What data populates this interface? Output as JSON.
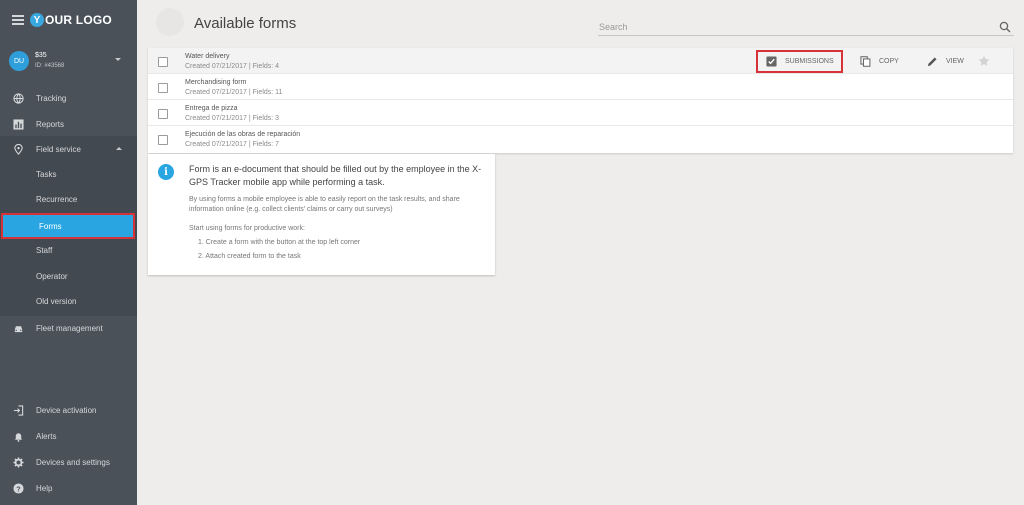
{
  "brand": {
    "logo_letter": "Y",
    "logo_text": "OUR LOGO"
  },
  "account": {
    "initials": "DU",
    "balance": "$35",
    "id": "ID: #43568"
  },
  "nav": {
    "tracking": "Tracking",
    "reports": "Reports",
    "field_service": "Field service",
    "sub": {
      "tasks": "Tasks",
      "recurrence": "Recurrence",
      "forms": "Forms",
      "staff": "Staff",
      "operator": "Operator",
      "old_version": "Old version"
    },
    "fleet": "Fleet management",
    "device_activation": "Device activation",
    "alerts": "Alerts",
    "devices_settings": "Devices and settings",
    "help": "Help"
  },
  "main": {
    "title": "Available forms",
    "search_placeholder": "Search"
  },
  "forms": [
    {
      "name": "Water delivery",
      "meta": "Created 07/21/2017 | Fields: 4"
    },
    {
      "name": "Merchandising form",
      "meta": "Created 07/21/2017 | Fields: 11"
    },
    {
      "name": "Entrega de pizza",
      "meta": "Created 07/21/2017 | Fields: 3"
    },
    {
      "name": "Ejecución de las obras de reparación",
      "meta": "Created 07/21/2017 | Fields: 7"
    }
  ],
  "row_actions": {
    "submissions": "SUBMISSIONS",
    "copy": "COPY",
    "view": "VIEW"
  },
  "info": {
    "icon": "i",
    "title": "Form is an e-document that should be filled out by the employee in the X-GPS Tracker mobile app while performing a task.",
    "body": "By using forms a mobile employee is able to easily report on the task results, and share information online (e.g. collect clients' claims or carry out surveys)",
    "start": "Start using forms for productive work:",
    "step1": "1. Create a form with the button at the top left corner",
    "step2": "2. Attach created form to the task"
  },
  "colors": {
    "sidebar": "#4a5159",
    "accent": "#29a6e1",
    "highlight": "#d63338"
  }
}
